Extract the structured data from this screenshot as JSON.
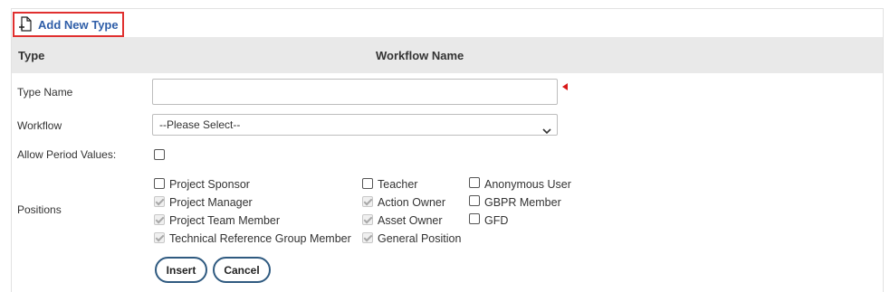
{
  "add_new": {
    "label": "Add New Type",
    "icon": "add-document-icon",
    "border_color": "#e0302f"
  },
  "table_header": {
    "type": "Type",
    "workflow_name": "Workflow Name"
  },
  "form": {
    "type_name": {
      "label": "Type Name",
      "value": ""
    },
    "workflow": {
      "label": "Workflow",
      "selected": "--Please Select--"
    },
    "allow_period": {
      "label": "Allow Period Values:",
      "checked": false
    },
    "positions": {
      "label": "Positions",
      "items": [
        {
          "label": "Project Sponsor",
          "checked": false,
          "disabled": false
        },
        {
          "label": "Project Manager",
          "checked": true,
          "disabled": true
        },
        {
          "label": "Project Team Member",
          "checked": true,
          "disabled": true
        },
        {
          "label": "Technical Reference Group Member",
          "checked": true,
          "disabled": true
        },
        {
          "label": "Teacher",
          "checked": false,
          "disabled": false
        },
        {
          "label": "Action Owner",
          "checked": true,
          "disabled": true
        },
        {
          "label": "Asset Owner",
          "checked": true,
          "disabled": true
        },
        {
          "label": "General Position",
          "checked": true,
          "disabled": true
        },
        {
          "label": "Anonymous User",
          "checked": false,
          "disabled": false
        },
        {
          "label": "GBPR Member",
          "checked": false,
          "disabled": false
        },
        {
          "label": "GFD",
          "checked": false,
          "disabled": false
        }
      ]
    }
  },
  "buttons": {
    "insert": "Insert",
    "cancel": "Cancel"
  },
  "colors": {
    "link": "#2f5ea8",
    "header_bg": "#e9e9e9",
    "button_border": "#2f5a80",
    "required": "#d81818"
  }
}
